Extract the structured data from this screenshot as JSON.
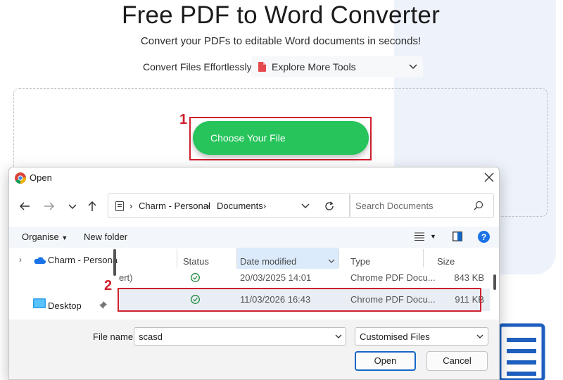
{
  "page": {
    "headline": "Free PDF to Word Converter",
    "subheadline": "Convert your PDFs to editable Word documents in seconds!",
    "convert_label": "Convert Files Effortlessly",
    "tools_dropdown": "Explore More Tools",
    "choose_button": "Choose Your File"
  },
  "annotations": [
    "1",
    "2"
  ],
  "dialog": {
    "title": "Open",
    "breadcrumb": [
      "Charm - Personal",
      "Documents"
    ],
    "search_placeholder": "Search Documents",
    "toolbar": {
      "organise": "Organise",
      "new_folder": "New folder"
    },
    "nav_items": [
      "Charm - Persona",
      "Desktop"
    ],
    "columns": [
      "Status",
      "Date modified",
      "Type",
      "Size"
    ],
    "files": [
      {
        "name_fragment": "ert)",
        "date": "20/03/2025 14:01",
        "type": "Chrome PDF Docu...",
        "size": "843 KB"
      },
      {
        "name_fragment": "",
        "date": "11/03/2026 16:43",
        "type": "Chrome PDF Docu...",
        "size": "911 KB"
      }
    ],
    "file_name_label": "File name:",
    "file_name_value": "scasd",
    "file_type": "Customised Files",
    "open_button": "Open",
    "cancel_button": "Cancel"
  },
  "colors": {
    "accent_green": "#27c45c",
    "annotation_red": "#d0202e",
    "selection_blue": "#dcebfb",
    "primary_button_border": "#1467c7"
  }
}
